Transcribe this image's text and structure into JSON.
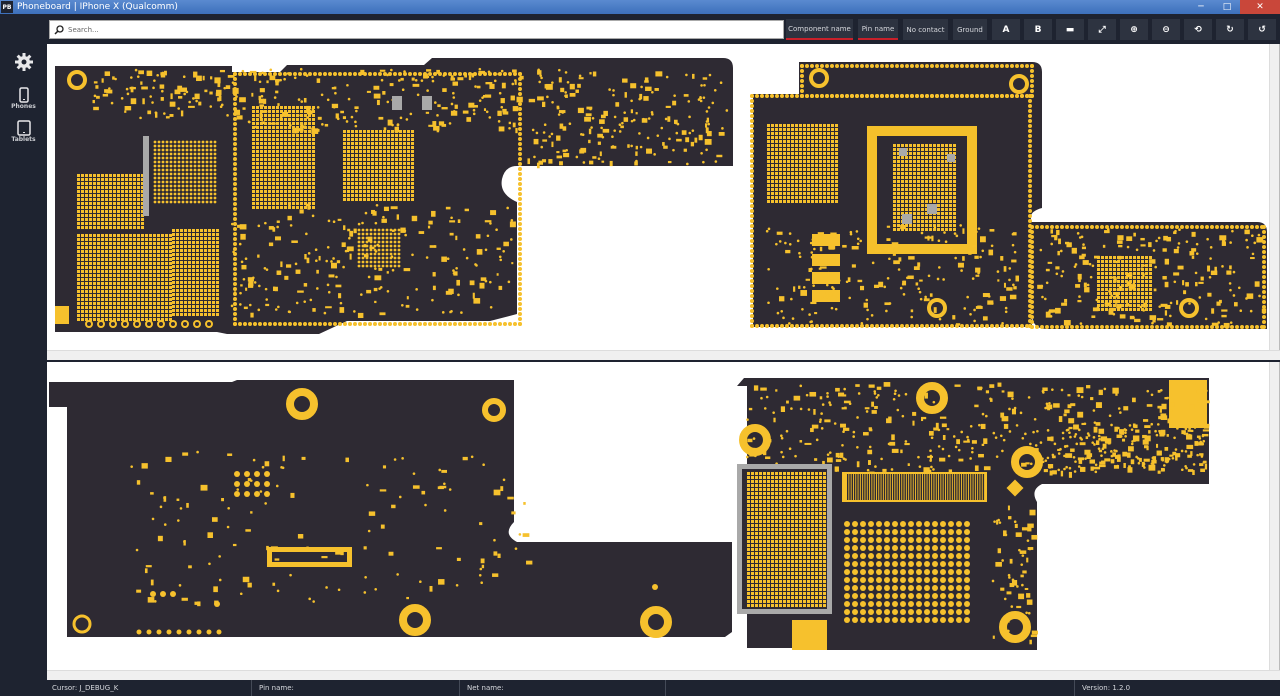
{
  "window": {
    "logo": "PB",
    "title": "Phoneboard | IPhone X (Qualcomm)",
    "minimize": "─",
    "maximize": "□",
    "close": "✕"
  },
  "sidebar": {
    "items": [
      {
        "icon": "gear-icon",
        "label": ""
      },
      {
        "icon": "phone-icon",
        "label": "Phones"
      },
      {
        "icon": "tablet-icon",
        "label": "Tablets"
      }
    ]
  },
  "toolbar": {
    "search_placeholder": "Search...",
    "buttons": [
      "Component name",
      "Pin name",
      "No contact",
      "Ground"
    ],
    "icon_buttons": [
      "font-large-icon",
      "font-bold-icon",
      "layers-icon",
      "fit-icon",
      "zoom-in-icon",
      "zoom-out-icon",
      "rotate-icon",
      "rotate-cw-icon",
      "rotate-ccw-icon"
    ],
    "icon_glyphs": [
      "A",
      "B",
      "▬",
      "⤢",
      "⊕",
      "⊖",
      "⟲",
      "↻",
      "↺"
    ]
  },
  "status": {
    "cursor": "Cursor: J_DEBUG_K",
    "pin": "Pin name:",
    "net": "Net name:",
    "version": "Version: 1.2.0"
  },
  "colors": {
    "board": "#2e2a33",
    "pad": "#f6c12d",
    "gray_pad": "#a9a9a9",
    "active_border": "#c8202a"
  }
}
